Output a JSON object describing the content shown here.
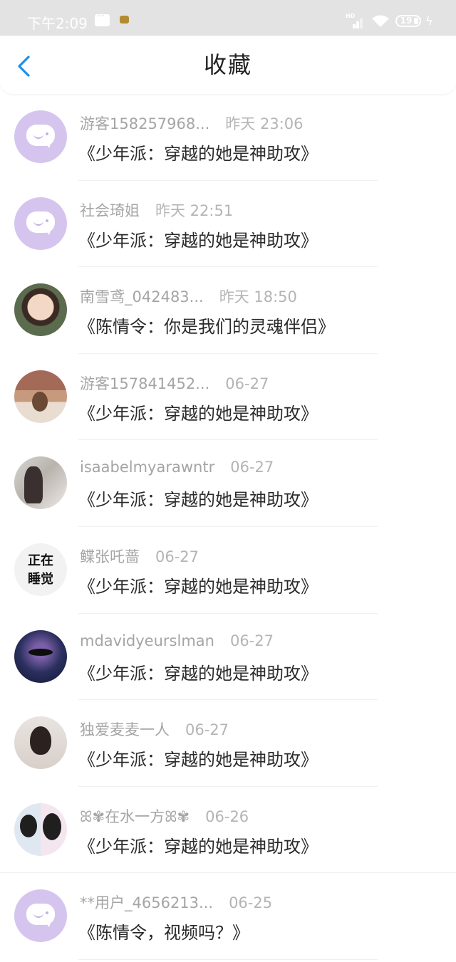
{
  "status_bar": {
    "time": "下午2:09",
    "battery": "19",
    "hd_label": "HD"
  },
  "header": {
    "title": "收藏"
  },
  "items": [
    {
      "user": "游客158257968...",
      "time": "昨天 23:06",
      "title": "《少年派：穿越的她是神助攻》",
      "avatar": "bubble"
    },
    {
      "user": "社会琦姐",
      "time": "昨天 22:51",
      "title": "《少年派：穿越的她是神助攻》",
      "avatar": "bubble"
    },
    {
      "user": "南雪鸢_042483...",
      "time": "昨天 18:50",
      "title": "《陈情令：你是我们的灵魂伴侣》",
      "avatar": "art"
    },
    {
      "user": "游客157841452...",
      "time": "06-27",
      "title": "《少年派：穿越的她是神助攻》",
      "avatar": "baby"
    },
    {
      "user": "isaabelmyarawntr",
      "time": "06-27",
      "title": "《少年派：穿越的她是神助攻》",
      "avatar": "girl"
    },
    {
      "user": "鲽张吒蔷",
      "time": "06-27",
      "title": "《少年派：穿越的她是神助攻》",
      "avatar": "text",
      "avatar_text": "正在\n睡觉"
    },
    {
      "user": "mdavidyeurslman",
      "time": "06-27",
      "title": "《少年派：穿越的她是神助攻》",
      "avatar": "galaxy"
    },
    {
      "user": "独爱麦麦一人",
      "time": "06-27",
      "title": "《少年派：穿越的她是神助攻》",
      "avatar": "woman"
    },
    {
      "user": "ꕤ✾在水一方ꕤ✾",
      "time": "06-26",
      "title": "《少年派：穿越的她是神助攻》",
      "avatar": "cartoon"
    },
    {
      "user": "**用户_4656213...",
      "time": "06-25",
      "title": "《陈情令，视频吗？》",
      "avatar": "bubble"
    }
  ],
  "colors": {
    "accent": "#1e90e6",
    "status_bar_bg": "#e3e3e3",
    "avatar_default": "#d5c5ee"
  },
  "icons": {
    "back": "chevron-left-icon",
    "default_avatar": "chat-bubble-icon"
  }
}
